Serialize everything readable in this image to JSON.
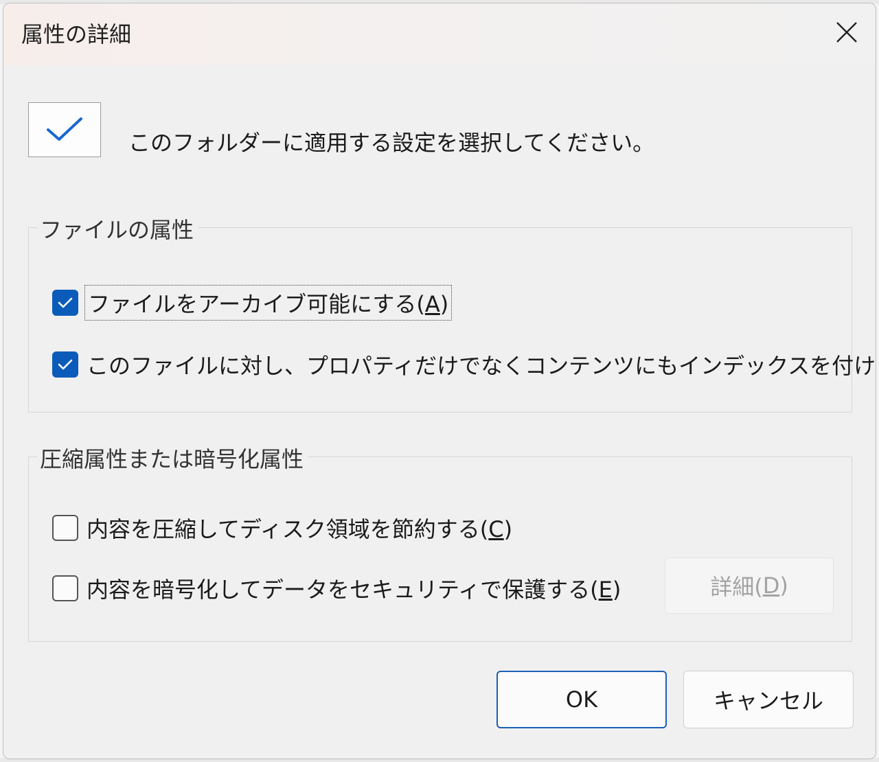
{
  "dialog": {
    "title": "属性の詳細",
    "header_text": "このフォルダーに適用する設定を選択してください。"
  },
  "file_attributes": {
    "label": "ファイルの属性",
    "archive": {
      "text": "ファイルをアーカイブ可能にする(",
      "key": "A",
      "close": ")",
      "checked": true
    },
    "index": {
      "text": "このファイルに対し、プロパティだけでなくコンテンツにもインデックスを付ける(",
      "key": "I",
      "close": ")",
      "checked": true
    }
  },
  "compress_encrypt": {
    "label": "圧縮属性または暗号化属性",
    "compress": {
      "text": "内容を圧縮してディスク領域を節約する(",
      "key": "C",
      "close": ")",
      "checked": false
    },
    "encrypt": {
      "text": "内容を暗号化してデータをセキュリティで保護する(",
      "key": "E",
      "close": ")",
      "checked": false
    },
    "details_button": {
      "text": "詳細(",
      "key": "D",
      "close": ")",
      "enabled": false
    }
  },
  "buttons": {
    "ok": "OK",
    "cancel": "キャンセル"
  },
  "colors": {
    "accent": "#0b5cba",
    "ok_border": "#1a5fb4",
    "disabled_text": "#a3a3a3"
  },
  "icons": {
    "close": "close-icon",
    "header": "checkmark-icon",
    "checkbox": "checkmark-icon"
  }
}
